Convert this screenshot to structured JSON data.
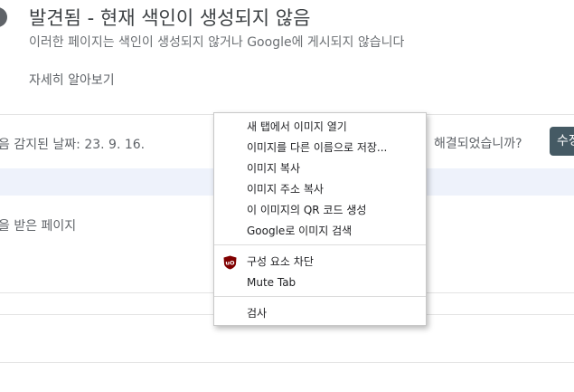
{
  "header": {
    "title": "발견됨 - 현재 색인이 생성되지 않음",
    "subtitle": "이러한 페이지는 색인이 생성되지 않거나 Google에 게시되지 않습니다",
    "learn_more": "자세히 알아보기"
  },
  "details": {
    "detected_date": "음 감지된 날짜: 23. 9. 16.",
    "resolved_question": "해결되었습니까?",
    "fix_button": "수정",
    "affected_pages": "을 받은 페이지"
  },
  "context_menu": {
    "items": [
      {
        "label": "새 탭에서 이미지 열기"
      },
      {
        "label": "이미지를 다른 이름으로 저장..."
      },
      {
        "label": "이미지 복사"
      },
      {
        "label": "이미지 주소 복사"
      },
      {
        "label": "이 이미지의 QR 코드 생성"
      },
      {
        "label": "Google로 이미지 검색"
      }
    ],
    "extension_items": [
      {
        "label": "구성 요소 차단",
        "icon": "ublock-origin-icon",
        "icon_text": "uO",
        "icon_color": "#800000"
      },
      {
        "label": "Mute Tab"
      }
    ],
    "inspect": {
      "label": "검사"
    }
  }
}
